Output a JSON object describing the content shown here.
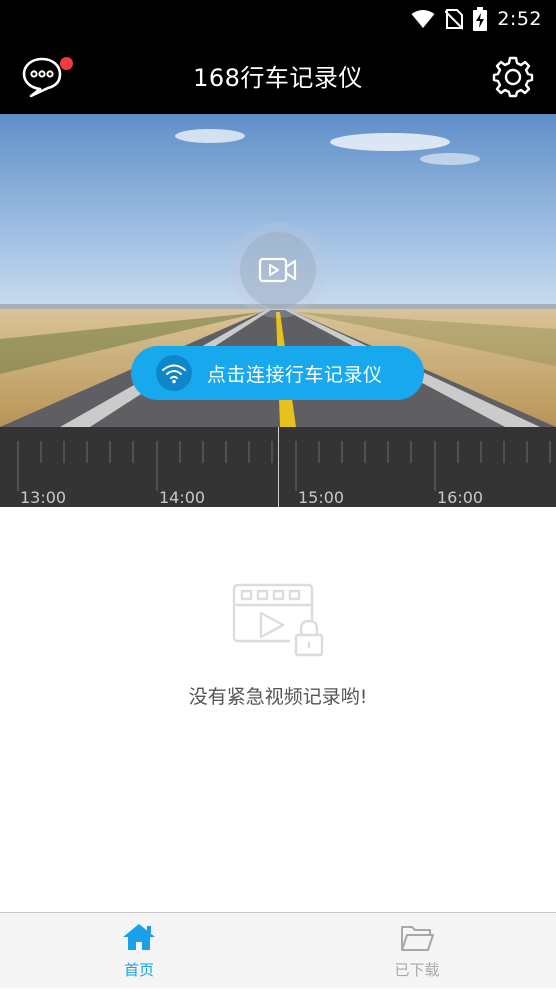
{
  "status_bar": {
    "time": "2:52"
  },
  "app_bar": {
    "title": "168行车记录仪"
  },
  "hero": {
    "connect_label": "点击连接行车记录仪"
  },
  "timeline": {
    "labels": [
      "13:00",
      "14:00",
      "15:00",
      "16:00"
    ]
  },
  "empty_state": {
    "message": "没有紧急视频记录哟!"
  },
  "bottom_nav": {
    "items": [
      {
        "label": "首页",
        "active": true
      },
      {
        "label": "已下载",
        "active": false
      }
    ]
  },
  "colors": {
    "accent": "#17a8ee",
    "nav_active": "#1aa0ea",
    "nav_inactive": "#a8a8a8",
    "notification_dot": "#f23b3b"
  }
}
